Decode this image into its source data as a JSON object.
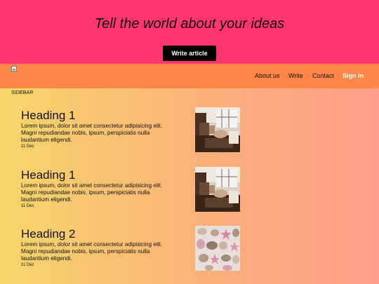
{
  "hero": {
    "title": "Tell the world about your ideas",
    "button_label": "Write article"
  },
  "navbar": {
    "links": [
      "About us",
      "Write",
      "Contact"
    ],
    "sign_in": "Sign in"
  },
  "sidebar": {
    "label": "SIDEBAR"
  },
  "articles": [
    {
      "title": "Heading 1",
      "excerpt": "Lorem ipsum, dolor sit amet consectetur adipisicing elit. Magni repudiandae nobis, ipsum, perspiciatis nulla laudantium eligendi.",
      "date": "11 Dec",
      "image": "interior-photo"
    },
    {
      "title": "Heading 1",
      "excerpt": "Lorem ipsum, dolor sit amet consectetur adipisicing elit. Magni repudiandae nobis, ipsum, perspiciatis nulla laudantium eligendi.",
      "date": "11 Dec",
      "image": "interior-photo"
    },
    {
      "title": "Heading 2",
      "excerpt": "Lorem ipsum, dolor sit amet consectetur adipisicing elit. Magni repudiandae nobis, ipsum, perspiciatis nulla laudantium eligendi.",
      "date": "11 Dec",
      "image": "seashells-photo"
    }
  ],
  "colors": {
    "hero_bg": "#ff3570",
    "navbar_bg": "#ff8745",
    "button_bg": "#000000",
    "gradient_start": "#f7d76a",
    "gradient_end": "#fd9e8a"
  }
}
